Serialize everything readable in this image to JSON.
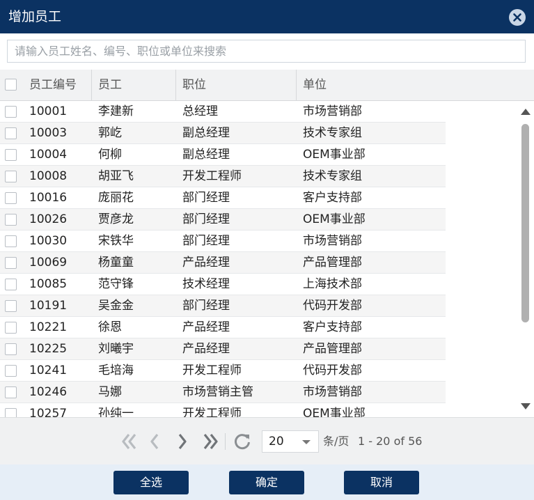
{
  "dialog": {
    "title": "增加员工",
    "close_icon": "close-circle-icon"
  },
  "search": {
    "placeholder": "请输入员工姓名、编号、职位或单位来搜索",
    "value": ""
  },
  "columns": {
    "id": "员工编号",
    "name": "员工",
    "position": "职位",
    "unit": "单位"
  },
  "rows": [
    {
      "id": "10001",
      "name": "李建新",
      "position": "总经理",
      "unit": "市场营销部"
    },
    {
      "id": "10003",
      "name": "郭屹",
      "position": "副总经理",
      "unit": "技术专家组"
    },
    {
      "id": "10004",
      "name": "何柳",
      "position": "副总经理",
      "unit": "OEM事业部"
    },
    {
      "id": "10008",
      "name": "胡亚飞",
      "position": "开发工程师",
      "unit": "技术专家组"
    },
    {
      "id": "10016",
      "name": "庞丽花",
      "position": "部门经理",
      "unit": "客户支持部"
    },
    {
      "id": "10026",
      "name": "贾彦龙",
      "position": "部门经理",
      "unit": "OEM事业部"
    },
    {
      "id": "10030",
      "name": "宋铁华",
      "position": "部门经理",
      "unit": "市场营销部"
    },
    {
      "id": "10069",
      "name": "杨童童",
      "position": "产品经理",
      "unit": "产品管理部"
    },
    {
      "id": "10085",
      "name": "范守锋",
      "position": "技术经理",
      "unit": "上海技术部"
    },
    {
      "id": "10191",
      "name": "吴金金",
      "position": "部门经理",
      "unit": "代码开发部"
    },
    {
      "id": "10221",
      "name": "徐恩",
      "position": "产品经理",
      "unit": "客户支持部"
    },
    {
      "id": "10225",
      "name": "刘曦宇",
      "position": "产品经理",
      "unit": "产品管理部"
    },
    {
      "id": "10241",
      "name": "毛培海",
      "position": "开发工程师",
      "unit": "代码开发部"
    },
    {
      "id": "10246",
      "name": "马娜",
      "position": "市场营销主管",
      "unit": "市场营销部"
    },
    {
      "id": "10257",
      "name": "孙纯一",
      "position": "开发工程师",
      "unit": "OEM事业部"
    }
  ],
  "pager": {
    "icons": [
      "first-page-icon",
      "prev-page-icon",
      "next-page-icon",
      "last-page-icon",
      "refresh-icon"
    ],
    "page_size": "20",
    "per_page_label": "条/页",
    "range_text": "1 - 20 of 56"
  },
  "buttons": {
    "select_all": "全选",
    "confirm": "确定",
    "cancel": "取消"
  },
  "colors": {
    "header_bg": "#0b3262",
    "footer_bg": "#e6eef7",
    "pager_bg": "#f0f1f2",
    "row_alt_bg": "#f5f5f5"
  }
}
